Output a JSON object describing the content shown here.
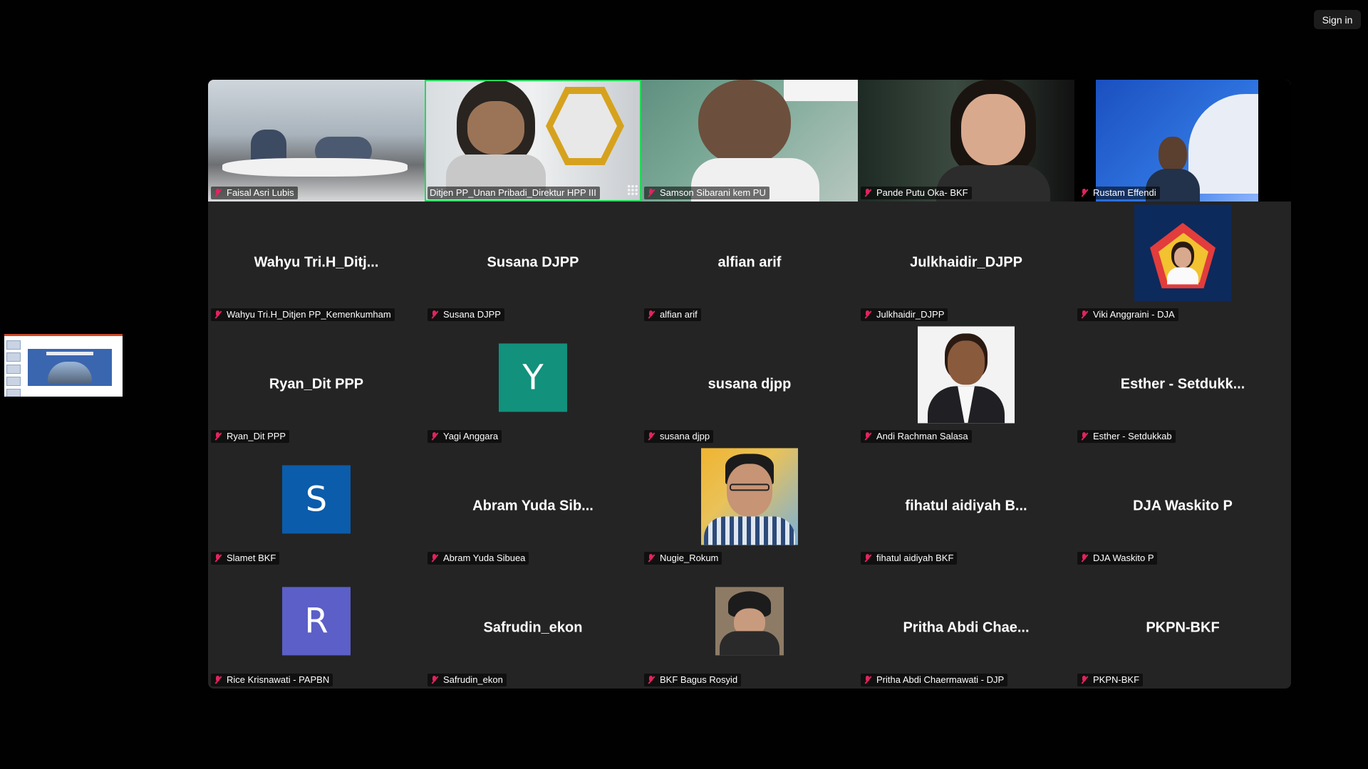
{
  "header": {
    "sign_in": "Sign in"
  },
  "grid": {
    "rows": [
      [
        {
          "display": "video",
          "label": "Faisal Asri Lubis"
        },
        {
          "display": "video",
          "label": "Ditjen PP_Unan Pribadi_Direktur HPP III",
          "active_speaker": true
        },
        {
          "display": "video",
          "label": "Samson Sibarani kem PU"
        },
        {
          "display": "video",
          "label": "Pande Putu Oka- BKF"
        },
        {
          "display": "video",
          "label": "Rustam Effendi"
        }
      ],
      [
        {
          "display": "name",
          "name": "Wahyu  Tri.H_Ditj...",
          "label": "Wahyu Tri.H_Ditjen PP_Kemenkumham"
        },
        {
          "display": "name",
          "name": "Susana DJPP",
          "label": "Susana DJPP"
        },
        {
          "display": "name",
          "name": "alfian arif",
          "label": "alfian arif"
        },
        {
          "display": "name",
          "name": "Julkhaidir_DJPP",
          "label": "Julkhaidir_DJPP"
        },
        {
          "display": "photo",
          "label": "Viki Anggraini - DJA"
        }
      ],
      [
        {
          "display": "name",
          "name": "Ryan_Dit PPP",
          "label": "Ryan_Dit PPP"
        },
        {
          "display": "initial",
          "initial": "Y",
          "color": "#12917c",
          "label": "Yagi Anggara"
        },
        {
          "display": "name",
          "name": "susana djpp",
          "label": "susana djpp"
        },
        {
          "display": "photo",
          "label": "Andi Rachman Salasa"
        },
        {
          "display": "name",
          "name": "Esther - Setdukk...",
          "label": "Esther - Setdukkab"
        }
      ],
      [
        {
          "display": "initial",
          "initial": "S",
          "color": "#0b5cab",
          "label": "Slamet BKF"
        },
        {
          "display": "name",
          "name": "Abram Yuda Sib...",
          "label": "Abram Yuda Sibuea"
        },
        {
          "display": "photo",
          "label": "Nugie_Rokum"
        },
        {
          "display": "name",
          "name": "fihatul aidiyah B...",
          "label": "fihatul aidiyah BKF"
        },
        {
          "display": "name",
          "name": "DJA Waskito P",
          "label": "DJA Waskito P"
        }
      ],
      [
        {
          "display": "initial",
          "initial": "R",
          "color": "#5b5fc7",
          "label": "Rice Krisnawati - PAPBN"
        },
        {
          "display": "name",
          "name": "Safrudin_ekon",
          "label": "Safrudin_ekon"
        },
        {
          "display": "photo",
          "label": "BKF Bagus Rosyid"
        },
        {
          "display": "name",
          "name": "Pritha Abdi Chae...",
          "label": "Pritha Abdi Chaermawati - DJP"
        },
        {
          "display": "name",
          "name": "PKPN-BKF",
          "label": "PKPN-BKF"
        }
      ]
    ]
  },
  "icons": {
    "muted_mic": "muted-mic-icon",
    "more_options": "more-options-icon"
  },
  "colors": {
    "active_speaker_border": "#23d959",
    "muted_mic": "#e0245e",
    "grid_bg": "#242424",
    "page_bg": "#010101"
  }
}
